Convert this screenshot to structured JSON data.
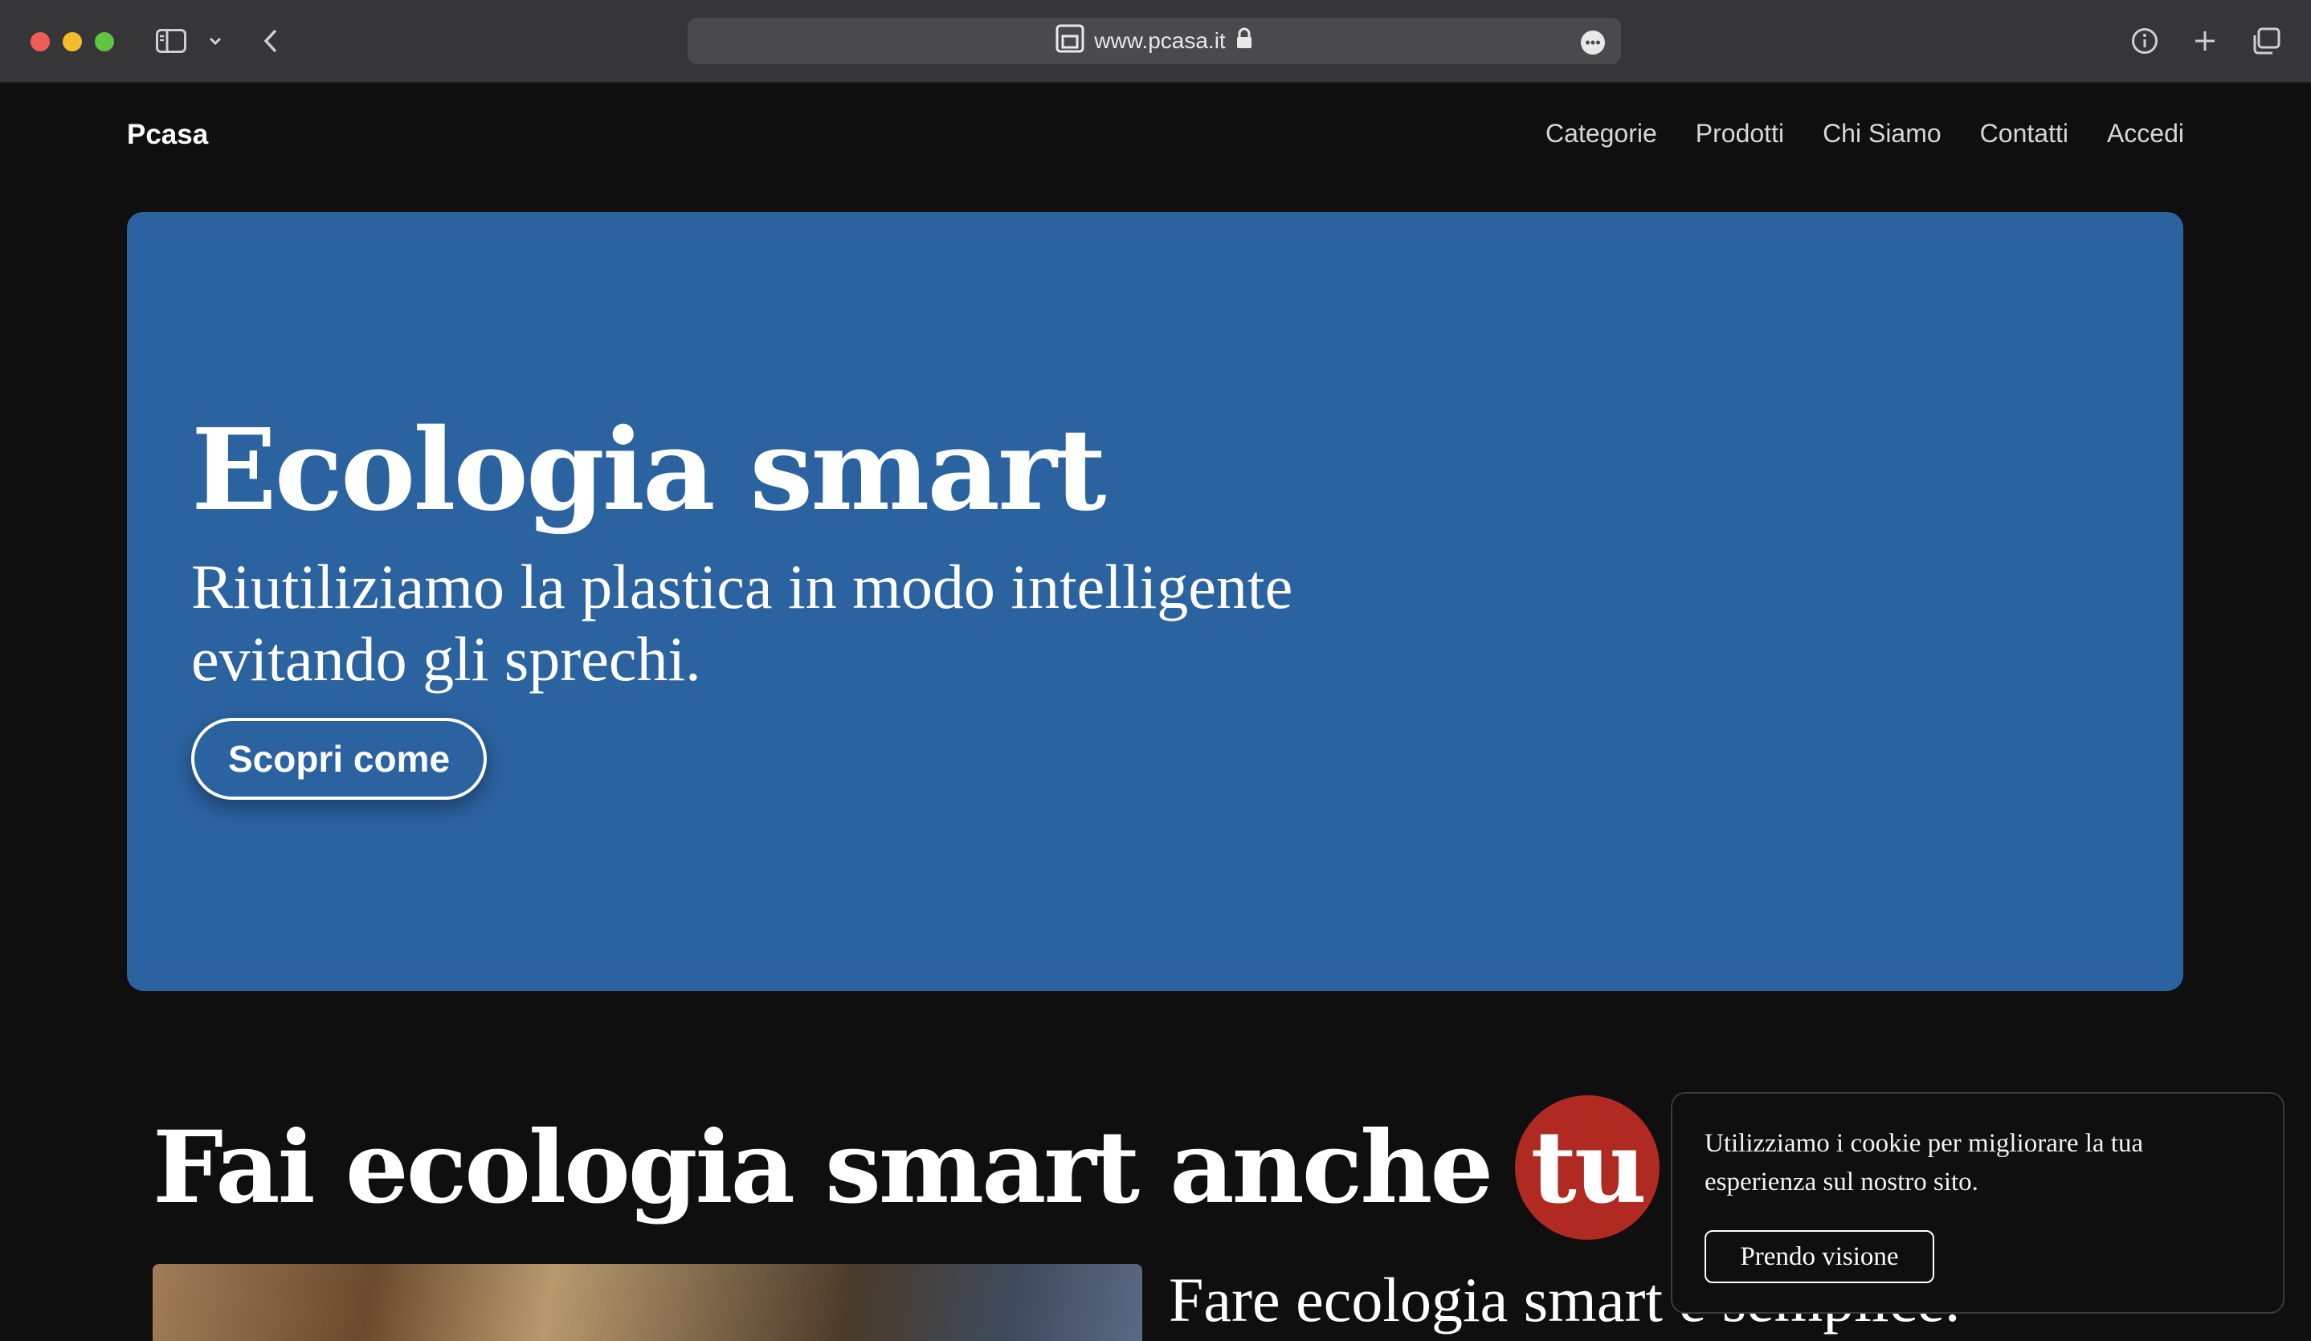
{
  "browser": {
    "url": "www.pcasa.it"
  },
  "nav": {
    "brand": "Pcasa",
    "links": [
      "Categorie",
      "Prodotti",
      "Chi Siamo",
      "Contatti",
      "Accedi"
    ]
  },
  "hero": {
    "title": "Ecologia smart",
    "subtitle": "Riutiliziamo la plastica in modo intelligente evitando gli sprechi.",
    "button": "Scopri come",
    "background": "#2b62a0"
  },
  "section": {
    "title": "Fai ecologia smart anche",
    "highlight": "tu",
    "highlight_color": "#b02a22",
    "subtitle": "Fare ecologia smart è semplice."
  },
  "cookie": {
    "text": "Utilizziamo i cookie per migliorare la tua esperienza sul nostro sito.",
    "button": "Prendo visione"
  },
  "icons": [
    "sidebar-icon",
    "chevron-down-icon",
    "back-icon",
    "site-icon",
    "lock-icon",
    "more-icon",
    "info-icon",
    "plus-icon",
    "tabs-icon"
  ]
}
